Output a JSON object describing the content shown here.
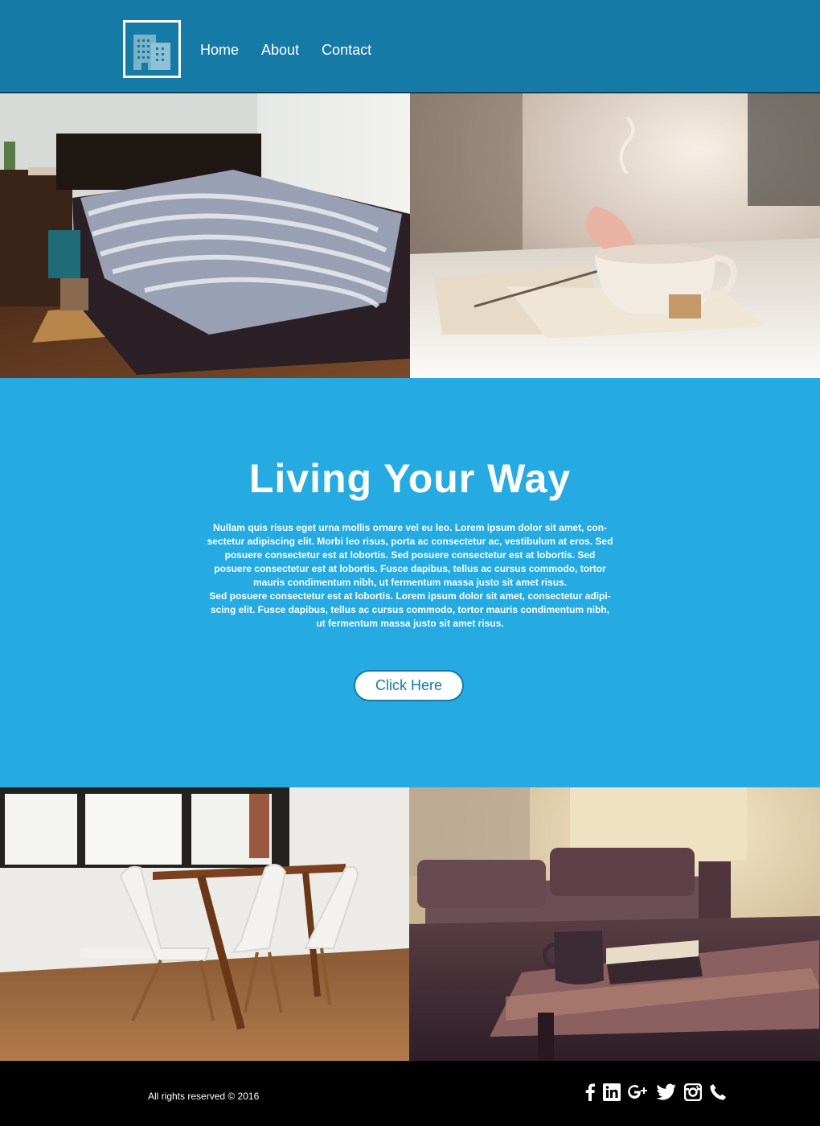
{
  "header": {
    "nav": [
      "Home",
      "About",
      "Contact"
    ],
    "logo_icon": "building-icon"
  },
  "hero": {
    "title": "Living Your Way",
    "paragraph1": "Nullam quis risus eget urna mollis ornare vel eu leo. Lorem ipsum dolor sit amet, con-sectetur adipiscing elit. Morbi leo risus, porta ac consectetur ac, vestibulum at eros. Sed posuere consectetur est at lobortis. Sed posuere consectetur est at lobortis. Sed posuere consectetur est at lobortis. Fusce dapibus, tellus ac cursus commodo, tortor mauris condimentum nibh, ut fermentum massa justo sit amet risus.",
    "paragraph2": "Sed posuere consectetur est at lobortis. Lorem ipsum dolor sit amet, consectetur adipi-scing elit. Fusce dapibus, tellus ac cursus commodo, tortor mauris condimentum nibh, ut fermentum massa justo sit amet risus.",
    "button": "Click Here"
  },
  "footer": {
    "copyright": "All rights reserved © 2016",
    "social_icons": [
      "facebook-icon",
      "linkedin-icon",
      "google-plus-icon",
      "twitter-icon",
      "instagram-icon",
      "phone-icon"
    ]
  },
  "colors": {
    "header": "#157aa5",
    "hero": "#25abe2",
    "footer": "#000000"
  }
}
